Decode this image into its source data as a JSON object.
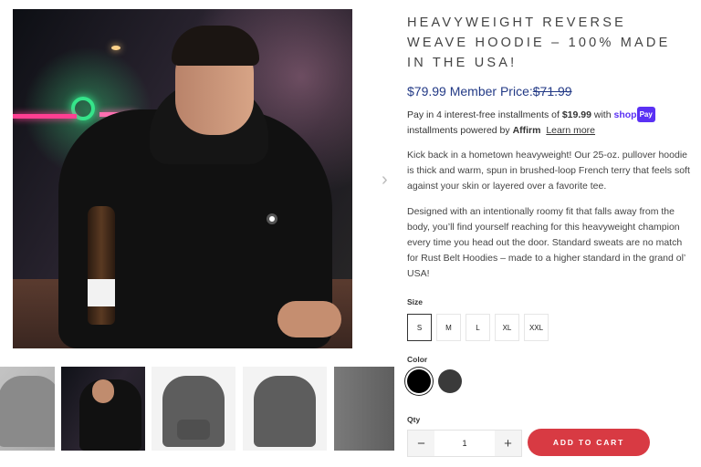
{
  "product": {
    "title": "HEAVYWEIGHT REVERSE WEAVE HOODIE – 100% MADE IN THE USA!",
    "price": "$79.99",
    "member_price_label": "Member Price:",
    "compare_price": "$71.99",
    "installments_prefix": "Pay in 4 interest-free installments of",
    "installment_amount": "$19.99",
    "installments_with": "with",
    "shop_label": "shop",
    "pay_label": "Pay",
    "installments_suffix": "installments powered by",
    "affirm_label": "Affirm",
    "learn_more": "Learn more",
    "description_1": "Kick back in a hometown heavyweight! Our 25-oz. pullover hoodie is thick and warm, spun in brushed-loop French terry that feels soft against your skin or layered over a favorite tee.",
    "description_2": "Designed with an intentionally roomy fit that falls away from the body, you’ll find yourself reaching for this heavyweight champion every time you head out the door. Standard sweats are no match for Rust Belt Hoodies – made to a higher standard in the grand ol’ USA!"
  },
  "options": {
    "size_label": "Size",
    "sizes": [
      "S",
      "M",
      "L",
      "XL",
      "XXL"
    ],
    "selected_size": "S",
    "color_label": "Color",
    "colors": [
      {
        "name": "black",
        "hex": "#000000",
        "selected": true
      },
      {
        "name": "charcoal",
        "hex": "#3a3a3a",
        "selected": false
      }
    ],
    "qty_label": "Qty",
    "qty_value": "1",
    "minus_icon": "minus-icon",
    "plus_icon": "plus-icon"
  },
  "cart": {
    "add_to_cart_label": "ADD TO CART"
  },
  "gallery": {
    "next_icon": "chevron-right-icon",
    "next_glyph": "›"
  }
}
